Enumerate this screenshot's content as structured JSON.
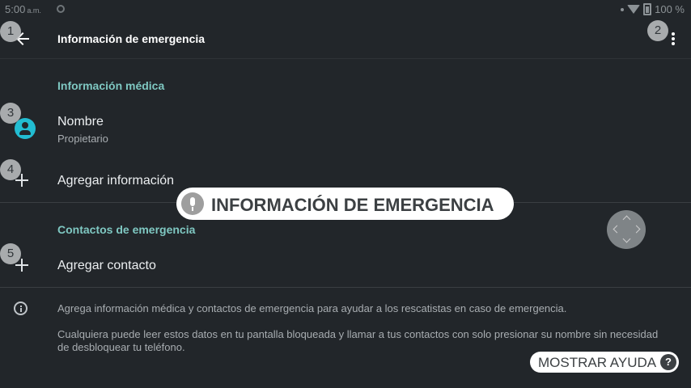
{
  "status_bar": {
    "time": "5:00",
    "ampm": "a.m.",
    "battery": "100 %"
  },
  "app_bar": {
    "title": "Información de emergencia"
  },
  "badges": [
    "1",
    "2",
    "3",
    "4",
    "5"
  ],
  "medical": {
    "header": "Información médica",
    "name_title": "Nombre",
    "name_value": "Propietario",
    "add_info": "Agregar información"
  },
  "contacts": {
    "header": "Contactos de emergencia",
    "add_contact": "Agregar contacto"
  },
  "footer": {
    "line1": "Agrega información médica y contactos de emergencia para ayudar a los rescatistas en caso de emergencia.",
    "line2": "Cualquiera puede leer estos datos en tu pantalla bloqueada y llamar a tus contactos con solo presionar su nombre sin necesidad de desbloquear tu teléfono."
  },
  "voice_overlay": {
    "label": "INFORMACIÓN DE EMERGENCIA"
  },
  "help_button": {
    "label": "MOSTRAR AYUDA",
    "icon": "?"
  },
  "colors": {
    "background": "#22262a",
    "accent": "#7fc8c2",
    "avatar": "#22bdd2"
  }
}
